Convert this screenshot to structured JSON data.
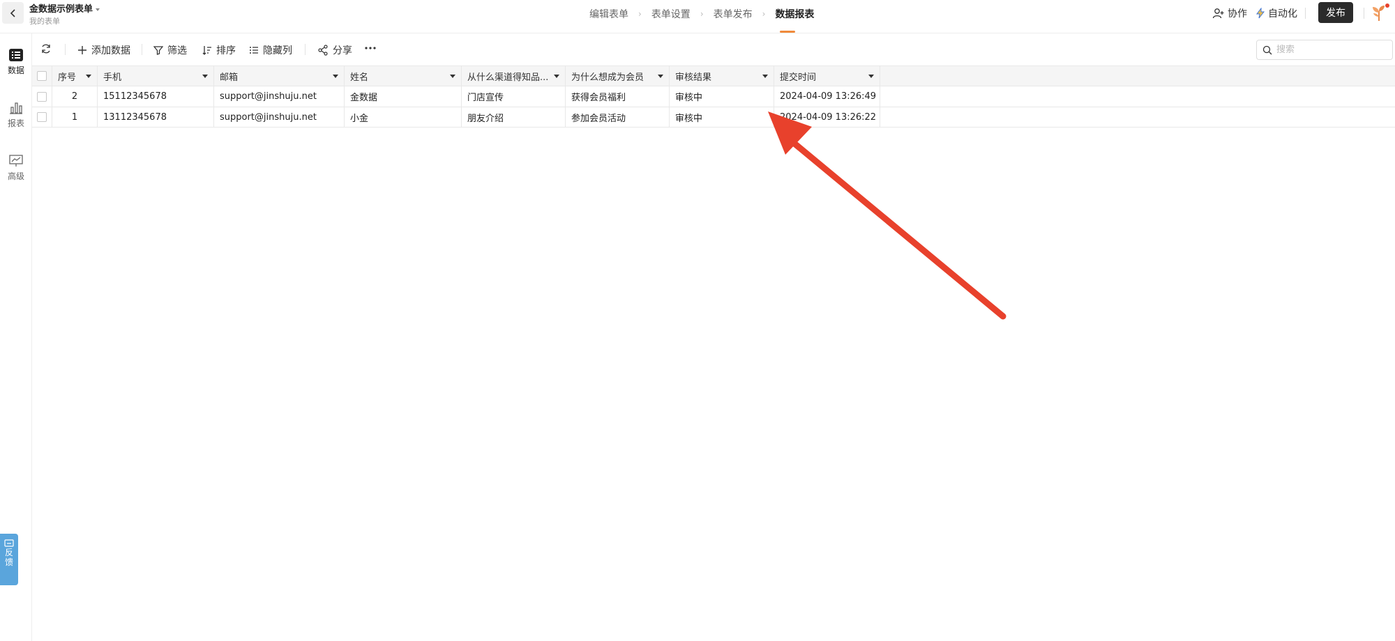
{
  "header": {
    "back_label": "",
    "form_title": "金数据示例表单",
    "form_subtitle": "我的表单",
    "steps": [
      "编辑表单",
      "表单设置",
      "表单发布",
      "数据报表"
    ],
    "active_step": "数据报表",
    "collab_label": "协作",
    "auto_label": "自动化",
    "publish_label": "发布"
  },
  "sidenav": {
    "items": [
      {
        "label": "数据",
        "icon": "list-icon"
      },
      {
        "label": "报表",
        "icon": "bar-chart-icon"
      },
      {
        "label": "高级",
        "icon": "presentation-icon"
      }
    ],
    "feedback_label": [
      "反",
      "馈"
    ]
  },
  "toolbar": {
    "refresh_icon": "refresh-icon",
    "add_data": "添加数据",
    "filter": "筛选",
    "sort": "排序",
    "hide_columns": "隐藏列",
    "share": "分享",
    "more_icon": "more-icon",
    "search_placeholder": "搜索"
  },
  "table": {
    "columns": [
      "序号",
      "手机",
      "邮箱",
      "姓名",
      "从什么渠道得知品...",
      "为什么想成为会员",
      "审核结果",
      "提交时间"
    ],
    "rows": [
      [
        "2",
        "15112345678",
        "support@jinshuju.net",
        "金数据",
        "门店宣传",
        "获得会员福利",
        "审核中",
        "2024-04-09 13:26:49"
      ],
      [
        "1",
        "13112345678",
        "support@jinshuju.net",
        "小金",
        "朋友介绍",
        "参加会员活动",
        "审核中",
        "2024-04-09 13:26:22"
      ]
    ]
  },
  "colors": {
    "accent": "#f08a3c",
    "publish_bg": "#2b2b2b",
    "feedback_bg": "#5aa5dc",
    "arrow": "#e8412c"
  }
}
